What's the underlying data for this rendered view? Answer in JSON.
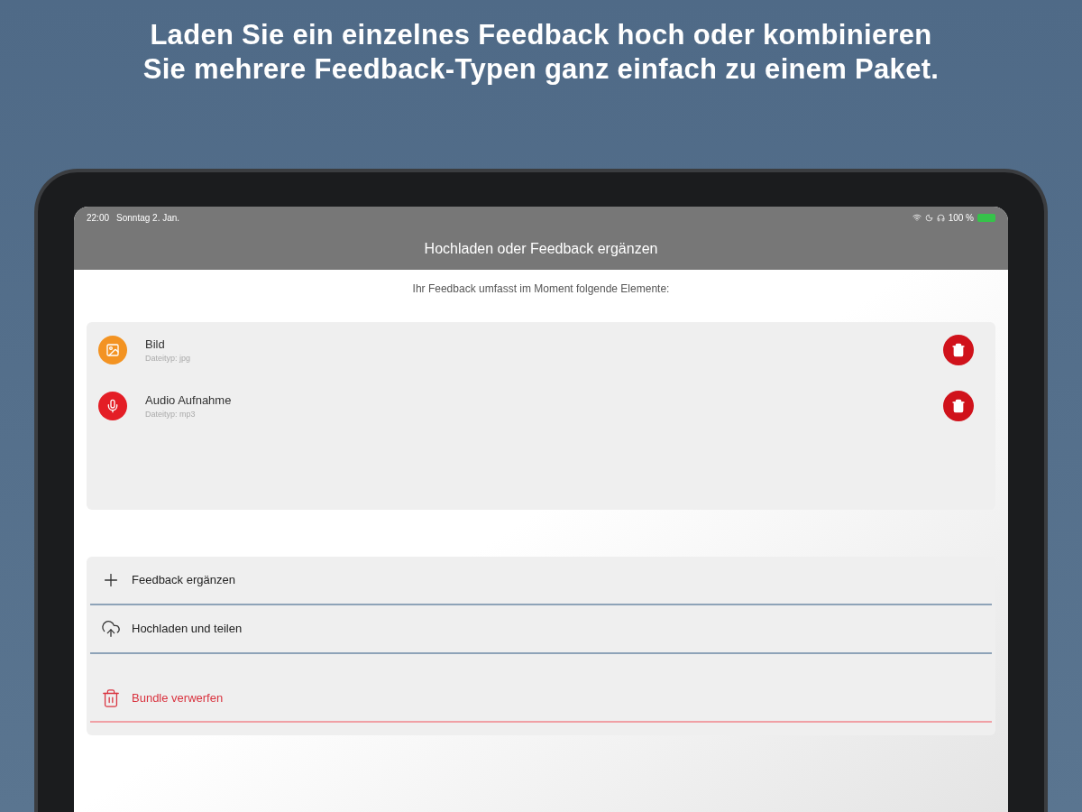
{
  "headline": [
    "Laden Sie ein einzelnes Feedback hoch oder kombinieren",
    "Sie mehrere Feedback-Typen ganz einfach zu einem Paket."
  ],
  "status_bar": {
    "time": "22:00",
    "date": "Sonntag 2. Jan.",
    "battery": "100 %"
  },
  "nav_title": "Hochladen oder Feedback ergänzen",
  "intro": "Ihr Feedback umfasst im Moment folgende Elemente:",
  "items": [
    {
      "kind": "image",
      "title": "Bild",
      "subtitle": "Dateityp: jpg",
      "color": "#f39322"
    },
    {
      "kind": "audio",
      "title": "Audio Aufnahme",
      "subtitle": "Dateityp: mp3",
      "color": "#e41e26"
    }
  ],
  "actions": [
    {
      "kind": "add",
      "label": "Feedback ergänzen"
    },
    {
      "kind": "upload",
      "label": "Hochladen und teilen"
    },
    {
      "kind": "discard",
      "label": "Bundle verwerfen"
    }
  ]
}
